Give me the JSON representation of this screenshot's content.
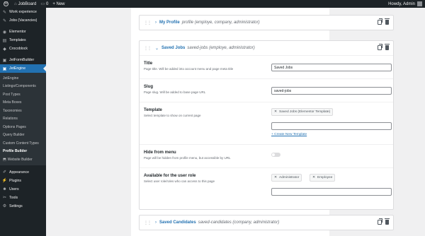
{
  "adminbar": {
    "site_name": "JobBoard",
    "comments_count": "0",
    "new_label": "+ New",
    "greeting": "Howdy, Admin"
  },
  "sidebar": {
    "items_top": [
      {
        "label": "Work experience",
        "icon": "pin-icon"
      },
      {
        "label": "Jobs (Vacancies)",
        "icon": "pin-icon"
      }
    ],
    "items_mid": [
      {
        "label": "Elementor",
        "icon": "elementor-icon"
      },
      {
        "label": "Templates",
        "icon": "folder-icon"
      },
      {
        "label": "Crocoblock",
        "icon": "crocoblock-icon"
      }
    ],
    "jetformbuilder": "JetFormBuilder",
    "jetengine": "JetEngine",
    "submenu": [
      "JetEngine",
      "Listings/Components",
      "Post Types",
      "Meta Boxes",
      "Taxonomies",
      "Relations",
      "Options Pages",
      "Query Builder",
      "Custom Content Types",
      "Profile Builder",
      "Website Builder"
    ],
    "current_sub": "Profile Builder",
    "items_bottom": [
      {
        "label": "Appearance",
        "icon": "brush-icon"
      },
      {
        "label": "Plugins",
        "icon": "plug-icon"
      },
      {
        "label": "Users",
        "icon": "users-icon"
      },
      {
        "label": "Tools",
        "icon": "wrench-icon"
      },
      {
        "label": "Settings",
        "icon": "settings-icon"
      }
    ]
  },
  "cards": {
    "my_profile": {
      "title": "My Profile",
      "sub": "profile (employe, company, administrator)"
    },
    "saved_jobs": {
      "title": "Saved Jobs",
      "sub": "saved-jobs (employe, administrator)"
    },
    "saved_candidates": {
      "title": "Saved Candidates",
      "sub": "saved-candidates (company, administrator)"
    }
  },
  "fields": {
    "title": {
      "label": "Title",
      "desc": "Page title. Will be added into account menu and page meta title",
      "value": "Saved Jobs"
    },
    "slug": {
      "label": "Slug",
      "desc": "Page slug. Will be added to base page URL",
      "value": "saved-jobs"
    },
    "template": {
      "label": "Template",
      "desc": "Select template to show on current page",
      "chip": "Saved Jobs (Elementor Template)",
      "link": "+ Create New Template"
    },
    "hide": {
      "label": "Hide from menu",
      "desc": "Page will be hidden from profile menu, but accessible by URL"
    },
    "roles": {
      "label": "Available for the user role",
      "desc": "Select user role/roles who can access to this page",
      "chips": [
        "Administrator",
        "Employee"
      ]
    }
  },
  "colors": {
    "accent": "#2271b1",
    "sidebar": "#1d2327",
    "active": "#2271b1"
  }
}
